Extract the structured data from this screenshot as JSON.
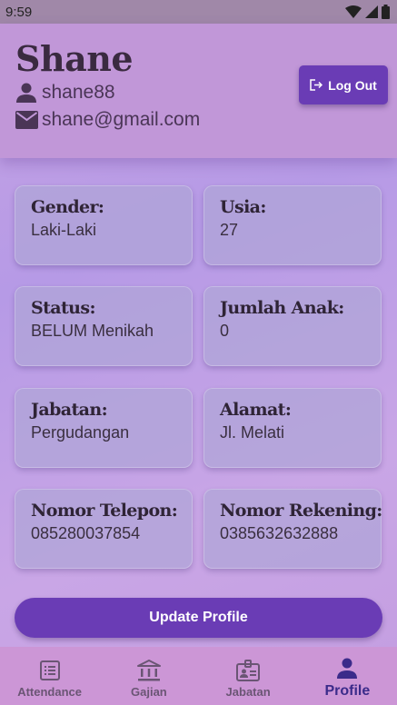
{
  "status_bar": {
    "time": "9:59"
  },
  "profile": {
    "name": "Shane",
    "username": "shane88",
    "email": "shane@gmail.com"
  },
  "actions": {
    "logout_label": "Log Out",
    "update_label": "Update Profile"
  },
  "fields": [
    {
      "label": "Gender:",
      "value": "Laki-Laki"
    },
    {
      "label": "Usia:",
      "value": "27"
    },
    {
      "label": "Status:",
      "value": "BELUM Menikah"
    },
    {
      "label": "Jumlah Anak:",
      "value": "0"
    },
    {
      "label": "Jabatan:",
      "value": "Pergudangan"
    },
    {
      "label": "Alamat:",
      "value": "Jl. Melati"
    },
    {
      "label": "Nomor Telepon:",
      "value": "085280037854"
    },
    {
      "label": "Nomor Rekening:",
      "value": "0385632632888"
    }
  ],
  "nav": [
    {
      "label": "Attendance",
      "icon": "list-alt-icon",
      "active": false
    },
    {
      "label": "Gajian",
      "icon": "bank-icon",
      "active": false
    },
    {
      "label": "Jabatan",
      "icon": "badge-icon",
      "active": false
    },
    {
      "label": "Profile",
      "icon": "person-icon",
      "active": true
    }
  ],
  "colors": {
    "primary": "#6a3cb5",
    "header_bg": "#c197d8",
    "nav_bg": "#cc96d6",
    "nav_active": "#3b2b8a"
  }
}
